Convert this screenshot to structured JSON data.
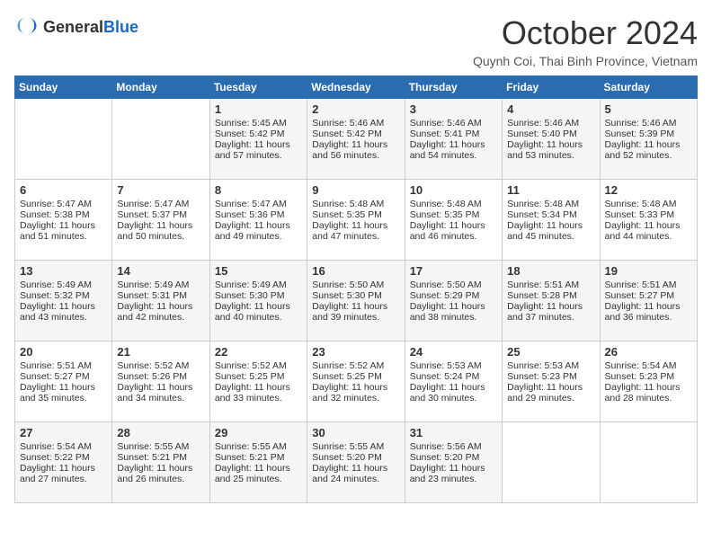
{
  "header": {
    "logo_general": "General",
    "logo_blue": "Blue",
    "title": "October 2024",
    "subtitle": "Quynh Coi, Thai Binh Province, Vietnam"
  },
  "weekdays": [
    "Sunday",
    "Monday",
    "Tuesday",
    "Wednesday",
    "Thursday",
    "Friday",
    "Saturday"
  ],
  "weeks": [
    [
      {
        "day": "",
        "text": ""
      },
      {
        "day": "",
        "text": ""
      },
      {
        "day": "1",
        "text": "Sunrise: 5:45 AM\nSunset: 5:42 PM\nDaylight: 11 hours and 57 minutes."
      },
      {
        "day": "2",
        "text": "Sunrise: 5:46 AM\nSunset: 5:42 PM\nDaylight: 11 hours and 56 minutes."
      },
      {
        "day": "3",
        "text": "Sunrise: 5:46 AM\nSunset: 5:41 PM\nDaylight: 11 hours and 54 minutes."
      },
      {
        "day": "4",
        "text": "Sunrise: 5:46 AM\nSunset: 5:40 PM\nDaylight: 11 hours and 53 minutes."
      },
      {
        "day": "5",
        "text": "Sunrise: 5:46 AM\nSunset: 5:39 PM\nDaylight: 11 hours and 52 minutes."
      }
    ],
    [
      {
        "day": "6",
        "text": "Sunrise: 5:47 AM\nSunset: 5:38 PM\nDaylight: 11 hours and 51 minutes."
      },
      {
        "day": "7",
        "text": "Sunrise: 5:47 AM\nSunset: 5:37 PM\nDaylight: 11 hours and 50 minutes."
      },
      {
        "day": "8",
        "text": "Sunrise: 5:47 AM\nSunset: 5:36 PM\nDaylight: 11 hours and 49 minutes."
      },
      {
        "day": "9",
        "text": "Sunrise: 5:48 AM\nSunset: 5:35 PM\nDaylight: 11 hours and 47 minutes."
      },
      {
        "day": "10",
        "text": "Sunrise: 5:48 AM\nSunset: 5:35 PM\nDaylight: 11 hours and 46 minutes."
      },
      {
        "day": "11",
        "text": "Sunrise: 5:48 AM\nSunset: 5:34 PM\nDaylight: 11 hours and 45 minutes."
      },
      {
        "day": "12",
        "text": "Sunrise: 5:48 AM\nSunset: 5:33 PM\nDaylight: 11 hours and 44 minutes."
      }
    ],
    [
      {
        "day": "13",
        "text": "Sunrise: 5:49 AM\nSunset: 5:32 PM\nDaylight: 11 hours and 43 minutes."
      },
      {
        "day": "14",
        "text": "Sunrise: 5:49 AM\nSunset: 5:31 PM\nDaylight: 11 hours and 42 minutes."
      },
      {
        "day": "15",
        "text": "Sunrise: 5:49 AM\nSunset: 5:30 PM\nDaylight: 11 hours and 40 minutes."
      },
      {
        "day": "16",
        "text": "Sunrise: 5:50 AM\nSunset: 5:30 PM\nDaylight: 11 hours and 39 minutes."
      },
      {
        "day": "17",
        "text": "Sunrise: 5:50 AM\nSunset: 5:29 PM\nDaylight: 11 hours and 38 minutes."
      },
      {
        "day": "18",
        "text": "Sunrise: 5:51 AM\nSunset: 5:28 PM\nDaylight: 11 hours and 37 minutes."
      },
      {
        "day": "19",
        "text": "Sunrise: 5:51 AM\nSunset: 5:27 PM\nDaylight: 11 hours and 36 minutes."
      }
    ],
    [
      {
        "day": "20",
        "text": "Sunrise: 5:51 AM\nSunset: 5:27 PM\nDaylight: 11 hours and 35 minutes."
      },
      {
        "day": "21",
        "text": "Sunrise: 5:52 AM\nSunset: 5:26 PM\nDaylight: 11 hours and 34 minutes."
      },
      {
        "day": "22",
        "text": "Sunrise: 5:52 AM\nSunset: 5:25 PM\nDaylight: 11 hours and 33 minutes."
      },
      {
        "day": "23",
        "text": "Sunrise: 5:52 AM\nSunset: 5:25 PM\nDaylight: 11 hours and 32 minutes."
      },
      {
        "day": "24",
        "text": "Sunrise: 5:53 AM\nSunset: 5:24 PM\nDaylight: 11 hours and 30 minutes."
      },
      {
        "day": "25",
        "text": "Sunrise: 5:53 AM\nSunset: 5:23 PM\nDaylight: 11 hours and 29 minutes."
      },
      {
        "day": "26",
        "text": "Sunrise: 5:54 AM\nSunset: 5:23 PM\nDaylight: 11 hours and 28 minutes."
      }
    ],
    [
      {
        "day": "27",
        "text": "Sunrise: 5:54 AM\nSunset: 5:22 PM\nDaylight: 11 hours and 27 minutes."
      },
      {
        "day": "28",
        "text": "Sunrise: 5:55 AM\nSunset: 5:21 PM\nDaylight: 11 hours and 26 minutes."
      },
      {
        "day": "29",
        "text": "Sunrise: 5:55 AM\nSunset: 5:21 PM\nDaylight: 11 hours and 25 minutes."
      },
      {
        "day": "30",
        "text": "Sunrise: 5:55 AM\nSunset: 5:20 PM\nDaylight: 11 hours and 24 minutes."
      },
      {
        "day": "31",
        "text": "Sunrise: 5:56 AM\nSunset: 5:20 PM\nDaylight: 11 hours and 23 minutes."
      },
      {
        "day": "",
        "text": ""
      },
      {
        "day": "",
        "text": ""
      }
    ]
  ]
}
